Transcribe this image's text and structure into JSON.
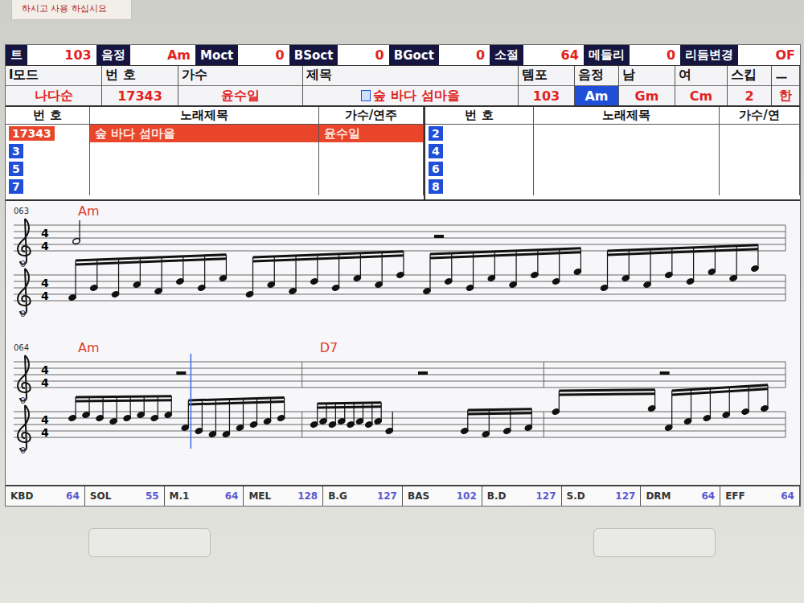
{
  "sticker": {
    "text": "하시고 사용 하십시요"
  },
  "top_bar": [
    {
      "label": "트",
      "value": "103"
    },
    {
      "label": "음정",
      "value": "Am"
    },
    {
      "label": "Moct",
      "value": "0"
    },
    {
      "label": "BSoct",
      "value": "0"
    },
    {
      "label": "BGoct",
      "value": "0"
    },
    {
      "label": "소절",
      "value": "64"
    },
    {
      "label": "메들리",
      "value": "0"
    },
    {
      "label": "리듬변경",
      "value": "OF"
    }
  ],
  "info": [
    {
      "label": "l모드",
      "value": "나다순",
      "selected": false
    },
    {
      "label": "번 호",
      "value": "17343",
      "selected": false
    },
    {
      "label": "가수",
      "value": "윤수일",
      "selected": false
    },
    {
      "label": "제목",
      "value": "숲 바다 섬마을",
      "selected": false
    },
    {
      "label": "템포",
      "value": "103",
      "selected": false
    },
    {
      "label": "음정",
      "value": "Am",
      "selected": true
    },
    {
      "label": "남",
      "value": "Gm",
      "selected": false
    },
    {
      "label": "여",
      "value": "Cm",
      "selected": false
    },
    {
      "label": "스킵",
      "value": "2",
      "selected": false
    },
    {
      "label": "ㅡ",
      "value": "한",
      "selected": false
    }
  ],
  "list": {
    "left": {
      "columns": [
        "번 호",
        "노래제목",
        "가수/연주"
      ],
      "rows": [
        {
          "number": "17343",
          "title": "숲 바다 섬마을",
          "artist": "윤수일",
          "selected": true
        },
        {
          "number": "3",
          "title": "",
          "artist": "",
          "selected": false
        },
        {
          "number": "5",
          "title": "",
          "artist": "",
          "selected": false
        },
        {
          "number": "7",
          "title": "",
          "artist": "",
          "selected": false
        }
      ]
    },
    "right": {
      "columns": [
        "번 호",
        "노래제목",
        "가수/연"
      ],
      "rows": [
        {
          "number": "2",
          "title": "",
          "artist": "",
          "selected": false
        },
        {
          "number": "4",
          "title": "",
          "artist": "",
          "selected": false
        },
        {
          "number": "6",
          "title": "",
          "artist": "",
          "selected": false
        },
        {
          "number": "8",
          "title": "",
          "artist": "",
          "selected": false
        }
      ]
    }
  },
  "score": {
    "time": {
      "top": "4",
      "bottom": "4"
    },
    "staff_label": "0",
    "systems": [
      {
        "number": "063",
        "measures": [
          {
            "chord": "Am",
            "melody": [
              {
                "kind": "half",
                "step": 3
              },
              {
                "kind": "rest",
                "step": 4
              }
            ],
            "accomp": [
              [
                1,
                4,
                2,
                5,
                3,
                6,
                4,
                7
              ],
              [
                2,
                5,
                3,
                6,
                4,
                7,
                5,
                8
              ],
              [
                3,
                6,
                4,
                7,
                5,
                8,
                6,
                9
              ],
              [
                4,
                7,
                5,
                8,
                6,
                9,
                7,
                10
              ]
            ]
          }
        ]
      },
      {
        "number": "064",
        "measures": [
          {
            "chord": "Am",
            "melody": [
              {
                "kind": "rest",
                "step": 4
              }
            ],
            "accomp": [
              [
                6,
                7,
                6,
                5,
                6,
                7,
                6,
                7
              ],
              [
                3,
                2,
                1,
                1,
                3,
                4,
                5,
                6
              ]
            ]
          },
          {
            "chord": "D7",
            "melody": [
              {
                "kind": "rest",
                "step": 4
              }
            ],
            "accomp": [
              [
                4,
                5,
                4,
                5,
                4,
                5,
                4,
                5
              ],
              [
                2
              ],
              [
                2,
                1,
                2,
                3
              ]
            ]
          },
          {
            "melody": [
              {
                "kind": "rest",
                "step": 4
              }
            ],
            "accomp": [
              [
                8,
                9
              ],
              [
                3,
                5,
                6,
                7,
                8,
                9
              ]
            ]
          }
        ]
      }
    ],
    "playhead": {
      "system": 1,
      "level": 0.18
    }
  },
  "mixer": [
    {
      "label": "KBD",
      "value": "64"
    },
    {
      "label": "SOL",
      "value": "55"
    },
    {
      "label": "M.1",
      "value": "64"
    },
    {
      "label": "MEL",
      "value": "128"
    },
    {
      "label": "B.G",
      "value": "127"
    },
    {
      "label": "BAS",
      "value": "102"
    },
    {
      "label": "B.D",
      "value": "127"
    },
    {
      "label": "S.D",
      "value": "127"
    },
    {
      "label": "DRM",
      "value": "64"
    },
    {
      "label": "EFF",
      "value": "64"
    }
  ]
}
